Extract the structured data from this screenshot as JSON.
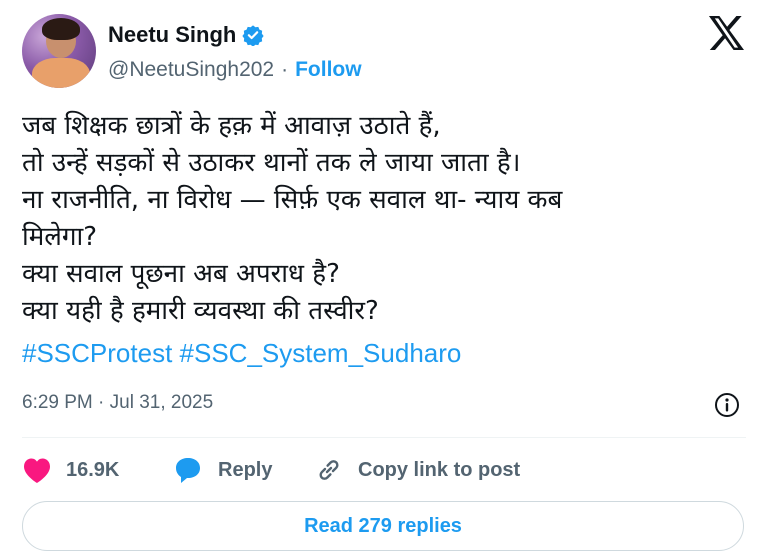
{
  "author": {
    "name": "Neetu Singh",
    "handle": "@NeetuSingh202",
    "separator": "·",
    "follow_label": "Follow",
    "verified": true,
    "avatar_icon": "user-avatar"
  },
  "brand": {
    "logo_icon": "x-logo-icon"
  },
  "tweet": {
    "lines": [
      "जब शिक्षक छात्रों के हक़ में आवाज़ उठाते हैं,",
      "तो उन्हें सड़कों से उठाकर थानों तक ले जाया जाता है।",
      "ना राजनीति, ना विरोध — सिर्फ़ एक सवाल था- न्याय कब",
      "मिलेगा?",
      "क्या सवाल पूछना अब अपराध है?",
      "क्या यही है हमारी व्यवस्था की तस्वीर?"
    ],
    "hashtags": [
      "#SSCProtest",
      "#SSC_System_Sudharo"
    ],
    "timestamp": "6:29 PM · Jul 31, 2025"
  },
  "actions": {
    "like_count": "16.9K",
    "reply_label": "Reply",
    "copy_link_label": "Copy link to post",
    "read_replies_label": "Read 279 replies"
  },
  "colors": {
    "accent": "#1d9bf0",
    "like": "#f91880",
    "text": "#0f1419",
    "muted": "#536471",
    "border": "#cfd9de"
  }
}
